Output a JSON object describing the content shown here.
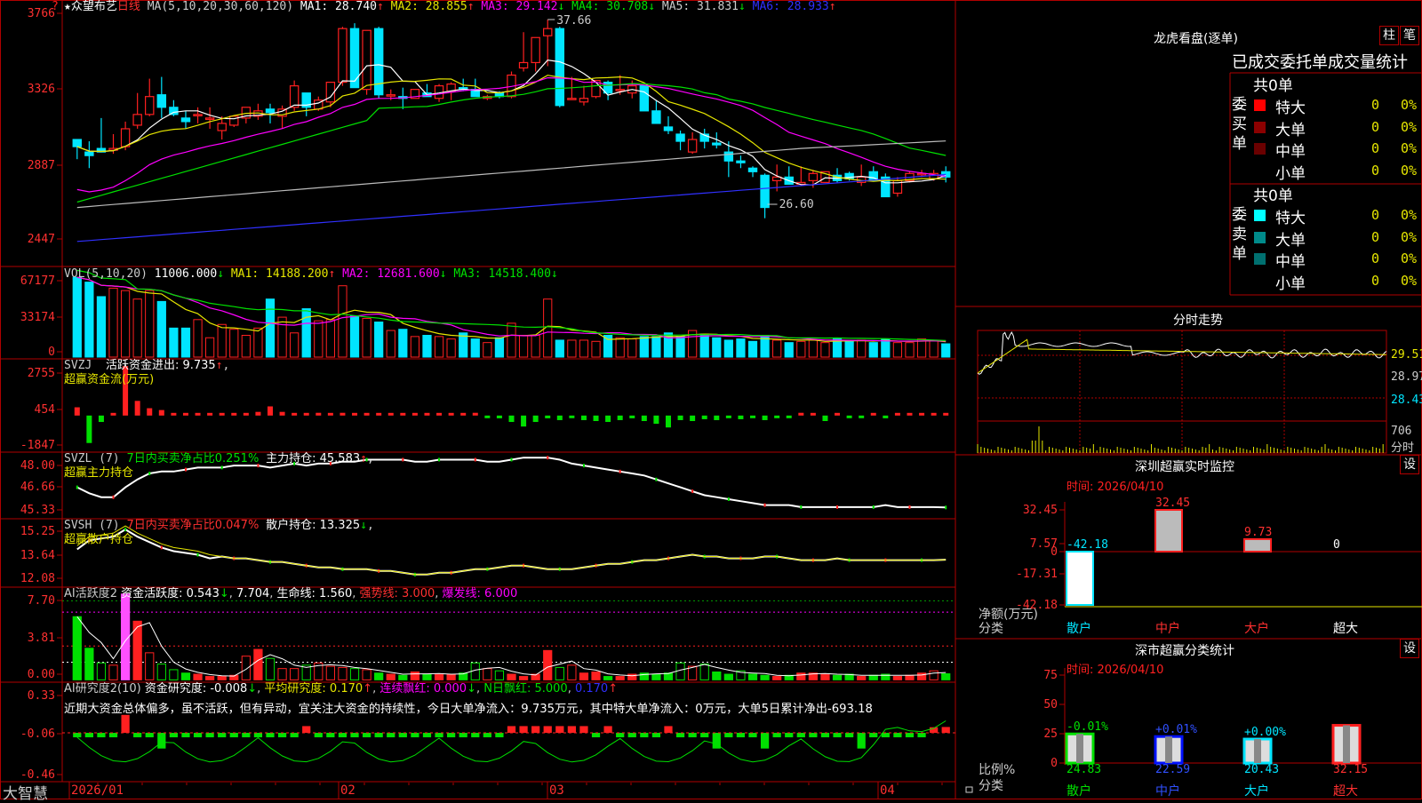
{
  "stock": {
    "marker": "★",
    "name": "众望布艺",
    "period": "日线"
  },
  "colors": {
    "up": "#ff2020",
    "down": "#00e5ff",
    "frame": "#b00000",
    "green": "#00e000",
    "yellow": "#e6e600",
    "magenta": "#ff00ff",
    "white": "#ffffff",
    "blue": "#3030ff"
  },
  "corner_icon": "?",
  "brand": "大智慧",
  "price_header": {
    "title": "MA(5,10,20,30,60,120)",
    "items": [
      {
        "label": "MA1: 28.740",
        "arrow": "↑",
        "color": "#ffffff"
      },
      {
        "label": "MA2: 28.855",
        "arrow": "↑",
        "color": "#e6e600"
      },
      {
        "label": "MA3: 29.142",
        "arrow": "↓",
        "color": "#ff00ff"
      },
      {
        "label": "MA4: 30.708",
        "arrow": "↓",
        "color": "#00e000"
      },
      {
        "label": "MA5: 31.831",
        "arrow": "↓",
        "color": "#cccccc"
      },
      {
        "label": "MA6: 28.933",
        "arrow": "↑",
        "color": "#3030ff"
      }
    ],
    "max_label": "37.66",
    "min_label": "26.60"
  },
  "vol_header": {
    "title": "VOL(5,10,20)",
    "value": "11006.000",
    "value_arrow": "↓",
    "items": [
      {
        "label": "MA1: 14188.200",
        "arrow": "↑",
        "color": "#e6e600"
      },
      {
        "label": "MA2: 12681.600",
        "arrow": "↓",
        "color": "#ff00ff"
      },
      {
        "label": "MA3: 14518.400",
        "arrow": "↓",
        "color": "#00e000"
      }
    ]
  },
  "svzj_header": {
    "title": "SVZJ",
    "line1": "活跃资金进出: 9.735",
    "arrow": "↑",
    "line2": "超赢资金流(万元)"
  },
  "svzl_header": {
    "title": "SVZL (7)",
    "ratio": "7日内买卖净占比0.251%",
    "hold": "主力持仓: 45.583",
    "arrow": "↑",
    "line2": "超赢主力持仓"
  },
  "svsh_header": {
    "title": "SVSH (7)",
    "ratio": "7日内买卖净占比0.047%",
    "hold": "散户持仓: 13.325",
    "arrow": "↓",
    "line2": "超赢散户持仓"
  },
  "ai1_header": {
    "title": "AI活跃度2",
    "a": "资金活跃度: 0.543",
    "a_arrow": "↓",
    "b": "7.704",
    "c": "生命线: 1.560",
    "d": "强势线: 3.000",
    "e": "爆发线: 6.000"
  },
  "ai2_header": {
    "title": "AI研究度2(10)",
    "a": "资金研究度: -0.008",
    "a_arrow": "↓",
    "b": "平均研究度: 0.170",
    "b_arrow": "↑",
    "c": "连续飘红: 0.000",
    "c_arrow": "↓",
    "d": "N日飘红: 5.000",
    "e": "0.170",
    "e_arrow": "↑"
  },
  "commentary": "近期大资金总体偏多，虽不活跃，但有异动，宜关注大资金的持续性，今日大单净流入：9.735万元，其中特大单净流入：0万元，大单5日累计净出-693.18",
  "y_axes": {
    "price": [
      "3766",
      "3326",
      "2887",
      "2447"
    ],
    "vol": [
      "67177",
      "33174",
      "0"
    ],
    "svzj": [
      "2755",
      "454",
      "-1847"
    ],
    "svzl": [
      "48.00",
      "46.66",
      "45.33"
    ],
    "svsh": [
      "15.25",
      "13.64",
      "12.08"
    ],
    "ai1": [
      "7.70",
      "3.81",
      "0.00"
    ],
    "ai2": [
      "0.33",
      "-0.06",
      "-0.46"
    ]
  },
  "x_axis": [
    "2026/01",
    "02",
    "03",
    "04"
  ],
  "lhb": {
    "title": "龙虎看盘(逐单)",
    "btn1": "柱",
    "btn2": "笔",
    "subtitle": "已成交委托单成交量统计",
    "buy": {
      "side": "委买单",
      "total": "共0单",
      "rows": [
        {
          "label": "特大",
          "count": "0",
          "pct": "0%",
          "color": "#ff0000"
        },
        {
          "label": "大单",
          "count": "0",
          "pct": "0%",
          "color": "#8b0000"
        },
        {
          "label": "中单",
          "count": "0",
          "pct": "0%",
          "color": "#6a0000"
        },
        {
          "label": "小单",
          "count": "0",
          "pct": "0%",
          "color": "#000000"
        }
      ]
    },
    "sell": {
      "side": "委卖单",
      "total": "共0单",
      "rows": [
        {
          "label": "特大",
          "count": "0",
          "pct": "0%",
          "color": "#00ffff"
        },
        {
          "label": "大单",
          "count": "0",
          "pct": "0%",
          "color": "#008b8b"
        },
        {
          "label": "中单",
          "count": "0",
          "pct": "0%",
          "color": "#007070"
        },
        {
          "label": "小单",
          "count": "0",
          "pct": "0%",
          "color": "#000000"
        }
      ]
    }
  },
  "fenshi": {
    "title": "分时走势",
    "labels": [
      "29.51",
      "28.97",
      "28.43"
    ],
    "vol_label": "706",
    "unit": "分时"
  },
  "szmon": {
    "title": "深圳超赢实时监控",
    "btn": "设",
    "time": "时间: 2026/04/10",
    "yaxis": [
      "32.45",
      "7.57",
      "0",
      "-17.31",
      "-42.18"
    ],
    "ylabel": "净额(万元)",
    "xlabel": "分类",
    "categories": [
      "散户",
      "中户",
      "大户",
      "超大"
    ],
    "values": [
      -42.18,
      32.45,
      9.73,
      0
    ],
    "value_labels": [
      "-42.18",
      "32.45",
      "9.73",
      "0"
    ]
  },
  "szcls": {
    "title": "深市超赢分类统计",
    "btn": "设",
    "time": "时间: 2026/04/10",
    "yaxis": [
      "75",
      "50",
      "25",
      "0"
    ],
    "ylabel": "比例%",
    "xlabel": "分类",
    "categories": [
      "散户",
      "中户",
      "大户",
      "超大"
    ],
    "values": [
      24.83,
      22.59,
      20.43,
      32.15
    ],
    "change_labels": [
      "-0.01%",
      "+0.01%",
      "+0.00%",
      ""
    ],
    "value_labels": [
      "24.83",
      "22.59",
      "20.43",
      "32.15"
    ]
  },
  "chart_data": {
    "type": "candlestick",
    "candles": [
      [
        31.0,
        31.0,
        29.9,
        30.6
      ],
      [
        30.3,
        30.9,
        29.4,
        30.1
      ],
      [
        30.5,
        32.2,
        30.4,
        30.3
      ],
      [
        30.4,
        31.3,
        30.2,
        30.5
      ],
      [
        30.6,
        32.0,
        30.4,
        31.6
      ],
      [
        31.8,
        33.6,
        31.6,
        32.4
      ],
      [
        32.4,
        34.4,
        32.3,
        33.4
      ],
      [
        33.5,
        34.5,
        32.2,
        32.8
      ],
      [
        32.8,
        33.2,
        32.3,
        32.4
      ],
      [
        32.2,
        32.6,
        31.6,
        32.0
      ],
      [
        32.4,
        32.8,
        31.9,
        32.4
      ],
      [
        32.2,
        32.8,
        31.6,
        32.2
      ],
      [
        31.5,
        32.3,
        31.0,
        31.9
      ],
      [
        31.8,
        32.1,
        31.7,
        32.3
      ],
      [
        32.2,
        32.5,
        31.9,
        32.8
      ],
      [
        32.3,
        33.0,
        32.1,
        32.6
      ],
      [
        32.7,
        33.0,
        31.9,
        32.5
      ],
      [
        32.3,
        32.9,
        31.6,
        32.7
      ],
      [
        32.8,
        34.3,
        32.6,
        34.0
      ],
      [
        33.6,
        33.6,
        32.3,
        32.8
      ],
      [
        32.7,
        33.4,
        32.6,
        33.2
      ],
      [
        33.1,
        33.5,
        32.8,
        34.2
      ],
      [
        34.2,
        37.3,
        34.0,
        37.2
      ],
      [
        37.2,
        37.5,
        33.9,
        33.9
      ],
      [
        33.8,
        34.8,
        33.5,
        37.1
      ],
      [
        37.2,
        37.3,
        33.3,
        33.5
      ],
      [
        33.5,
        33.8,
        33.2,
        33.5
      ],
      [
        33.4,
        33.9,
        32.7,
        33.3
      ],
      [
        33.3,
        33.6,
        33.3,
        33.8
      ],
      [
        33.6,
        34.1,
        33.4,
        33.4
      ],
      [
        33.3,
        34.1,
        33.1,
        34.0
      ],
      [
        33.7,
        34.2,
        33.2,
        34.1
      ],
      [
        33.9,
        34.4,
        33.7,
        33.8
      ],
      [
        33.8,
        34.4,
        33.4,
        33.4
      ],
      [
        33.3,
        33.5,
        33.2,
        33.4
      ],
      [
        33.6,
        33.7,
        33.3,
        33.4
      ],
      [
        33.4,
        34.8,
        33.3,
        34.6
      ],
      [
        35.0,
        37.0,
        34.8,
        35.3
      ],
      [
        35.3,
        36.6,
        34.8,
        36.7
      ],
      [
        36.8,
        37.7,
        35.1,
        37.2
      ],
      [
        37.2,
        37.3,
        32.8,
        32.9
      ],
      [
        33.3,
        34.5,
        33.3,
        33.3
      ],
      [
        33.1,
        34.0,
        32.9,
        33.3
      ],
      [
        33.4,
        34.2,
        33.3,
        34.3
      ],
      [
        34.2,
        34.3,
        33.2,
        33.6
      ],
      [
        33.8,
        34.6,
        33.5,
        33.8
      ],
      [
        33.6,
        34.3,
        33.3,
        34.0
      ],
      [
        34.0,
        34.0,
        32.6,
        32.6
      ],
      [
        32.6,
        33.2,
        31.9,
        31.9
      ],
      [
        31.7,
        32.3,
        31.3,
        31.5
      ],
      [
        31.3,
        31.5,
        30.4,
        30.9
      ],
      [
        30.3,
        31.4,
        30.2,
        31.0
      ],
      [
        31.3,
        31.6,
        30.5,
        30.9
      ],
      [
        30.8,
        31.4,
        30.5,
        30.7
      ],
      [
        30.3,
        30.9,
        28.9,
        29.8
      ],
      [
        29.8,
        30.1,
        29.4,
        29.7
      ],
      [
        29.4,
        29.5,
        28.9,
        29.2
      ],
      [
        29.0,
        29.1,
        26.6,
        27.2
      ],
      [
        28.7,
        29.6,
        28.1,
        28.9
      ],
      [
        28.9,
        29.5,
        28.5,
        28.5
      ],
      [
        28.5,
        29.5,
        28.4,
        28.6
      ],
      [
        28.7,
        29.3,
        28.3,
        29.1
      ],
      [
        28.6,
        29.2,
        28.6,
        29.2
      ],
      [
        29.0,
        29.4,
        28.6,
        28.7
      ],
      [
        29.1,
        29.2,
        28.7,
        28.8
      ],
      [
        28.6,
        29.6,
        28.4,
        28.9
      ],
      [
        29.2,
        29.5,
        28.7,
        28.7
      ],
      [
        28.9,
        29.1,
        27.8,
        27.8
      ],
      [
        28.0,
        28.9,
        27.8,
        28.7
      ],
      [
        28.7,
        29.2,
        28.6,
        29.1
      ],
      [
        29.1,
        29.3,
        28.9,
        29.1
      ],
      [
        28.8,
        29.3,
        28.7,
        29.1
      ],
      [
        29.2,
        29.5,
        28.6,
        28.9
      ]
    ],
    "volume": [
      66000,
      62000,
      50000,
      57000,
      55000,
      48000,
      55000,
      46000,
      24000,
      24000,
      31000,
      16000,
      27000,
      23000,
      18000,
      24000,
      48000,
      33000,
      20000,
      40000,
      30000,
      31000,
      59000,
      34000,
      32000,
      29000,
      22000,
      23000,
      17000,
      18000,
      17000,
      15000,
      20000,
      15000,
      12000,
      16000,
      28000,
      18000,
      18000,
      48000,
      14000,
      14000,
      14000,
      13000,
      18000,
      16000,
      15000,
      17000,
      17000,
      20000,
      17000,
      22000,
      19000,
      16000,
      14000,
      15000,
      13000,
      18000,
      14000,
      12000,
      13000,
      14000,
      12000,
      15000,
      13000,
      14000,
      12000,
      15000,
      12000,
      12000,
      15000,
      14000,
      11000
    ],
    "svzj": [
      450,
      -1500,
      -350,
      60,
      2700,
      800,
      400,
      300,
      0,
      100,
      100,
      50,
      50,
      0,
      50,
      200,
      500,
      200,
      0,
      100,
      150,
      100,
      150,
      80,
      0,
      50,
      50,
      50,
      0,
      0,
      0,
      100,
      0,
      150,
      -100,
      -150,
      -350,
      -600,
      -350,
      -150,
      -250,
      -100,
      -250,
      -300,
      -350,
      -250,
      -150,
      -300,
      -450,
      -650,
      -250,
      -300,
      -200,
      -250,
      -100,
      -200,
      -100,
      -250,
      -100,
      -50,
      150,
      50,
      -300,
      0,
      -50,
      -100,
      100,
      -150,
      0,
      0,
      0,
      50,
      9.7
    ],
    "svzl": [
      46.6,
      46.3,
      46.1,
      46.1,
      46.6,
      47.0,
      47.3,
      47.4,
      47.4,
      47.5,
      47.6,
      47.6,
      47.6,
      47.7,
      47.7,
      47.7,
      47.6,
      47.7,
      47.8,
      47.7,
      47.8,
      47.8,
      47.9,
      47.9,
      48.0,
      48.0,
      48.0,
      48.0,
      47.9,
      47.9,
      48.0,
      48.0,
      48.0,
      48.0,
      47.9,
      47.9,
      48.0,
      48.1,
      48.1,
      48.1,
      48.0,
      47.8,
      47.7,
      47.6,
      47.5,
      47.4,
      47.3,
      47.2,
      47.0,
      46.8,
      46.6,
      46.4,
      46.2,
      46.1,
      46.0,
      45.9,
      45.8,
      45.7,
      45.7,
      45.7,
      45.6,
      45.6,
      45.6,
      45.6,
      45.6,
      45.6,
      45.6,
      45.7,
      45.6,
      45.6,
      45.6,
      45.6,
      45.58
    ],
    "svsh": [
      13.9,
      14.4,
      14.5,
      14.6,
      15.0,
      14.6,
      14.3,
      14.0,
      13.8,
      13.7,
      13.6,
      13.4,
      13.5,
      13.4,
      13.4,
      13.3,
      13.2,
      13.2,
      13.1,
      13.0,
      12.9,
      12.9,
      12.8,
      12.8,
      12.8,
      12.7,
      12.7,
      12.6,
      12.5,
      12.5,
      12.6,
      12.6,
      12.7,
      12.8,
      12.8,
      12.9,
      13.0,
      13.0,
      12.9,
      12.8,
      12.8,
      12.8,
      12.9,
      13.0,
      13.1,
      13.1,
      13.2,
      13.3,
      13.3,
      13.4,
      13.5,
      13.6,
      13.5,
      13.5,
      13.4,
      13.4,
      13.4,
      13.5,
      13.5,
      13.4,
      13.3,
      13.3,
      13.3,
      13.4,
      13.3,
      13.3,
      13.3,
      13.3,
      13.3,
      13.3,
      13.3,
      13.3,
      13.325
    ],
    "ai1": [
      5.6,
      2.8,
      1.5,
      1.3,
      7.6,
      5.2,
      2.4,
      1.4,
      0.9,
      0.6,
      0.5,
      0.3,
      0.3,
      0.4,
      2.1,
      2.7,
      1.9,
      1.0,
      1.0,
      1.3,
      1.5,
      1.2,
      1.1,
      1.0,
      0.9,
      0.6,
      0.5,
      0.4,
      0.7,
      0.5,
      0.5,
      0.5,
      0.6,
      1.5,
      1.0,
      0.8,
      0.5,
      0.3,
      0.5,
      2.6,
      1.1,
      1.3,
      0.6,
      0.7,
      0.3,
      0.3,
      0.5,
      0.6,
      0.5,
      0.6,
      1.5,
      1.2,
      1.4,
      0.7,
      0.5,
      0.8,
      0.5,
      0.4,
      0.3,
      0.4,
      0.6,
      0.6,
      0.5,
      0.4,
      0.5,
      0.3,
      0.4,
      0.5,
      0.3,
      0.4,
      0.6,
      0.8,
      0.54
    ],
    "ai2": [
      -0.1,
      -0.1,
      -0.1,
      -0.1,
      0.1,
      -0.1,
      -0.1,
      -0.2,
      -0.1,
      -0.1,
      -0.1,
      -0.1,
      -0.1,
      -0.1,
      -0.1,
      -0.1,
      -0.1,
      -0.1,
      -0.1,
      0.0,
      -0.1,
      -0.1,
      -0.1,
      -0.1,
      -0.1,
      -0.1,
      -0.1,
      -0.1,
      -0.1,
      -0.1,
      -0.1,
      -0.1,
      -0.1,
      -0.1,
      -0.1,
      -0.1,
      0.0,
      0.0,
      0.0,
      0.0,
      0.0,
      0.0,
      0.0,
      -0.1,
      0.0,
      -0.1,
      -0.1,
      -0.1,
      -0.1,
      0.0,
      -0.1,
      -0.1,
      -0.1,
      -0.2,
      -0.1,
      -0.1,
      -0.1,
      -0.2,
      -0.1,
      -0.1,
      -0.1,
      -0.1,
      -0.1,
      -0.1,
      -0.1,
      -0.2,
      -0.1,
      -0.1,
      -0.1,
      -0.1,
      -0.1,
      -0.01,
      -0.008
    ]
  }
}
